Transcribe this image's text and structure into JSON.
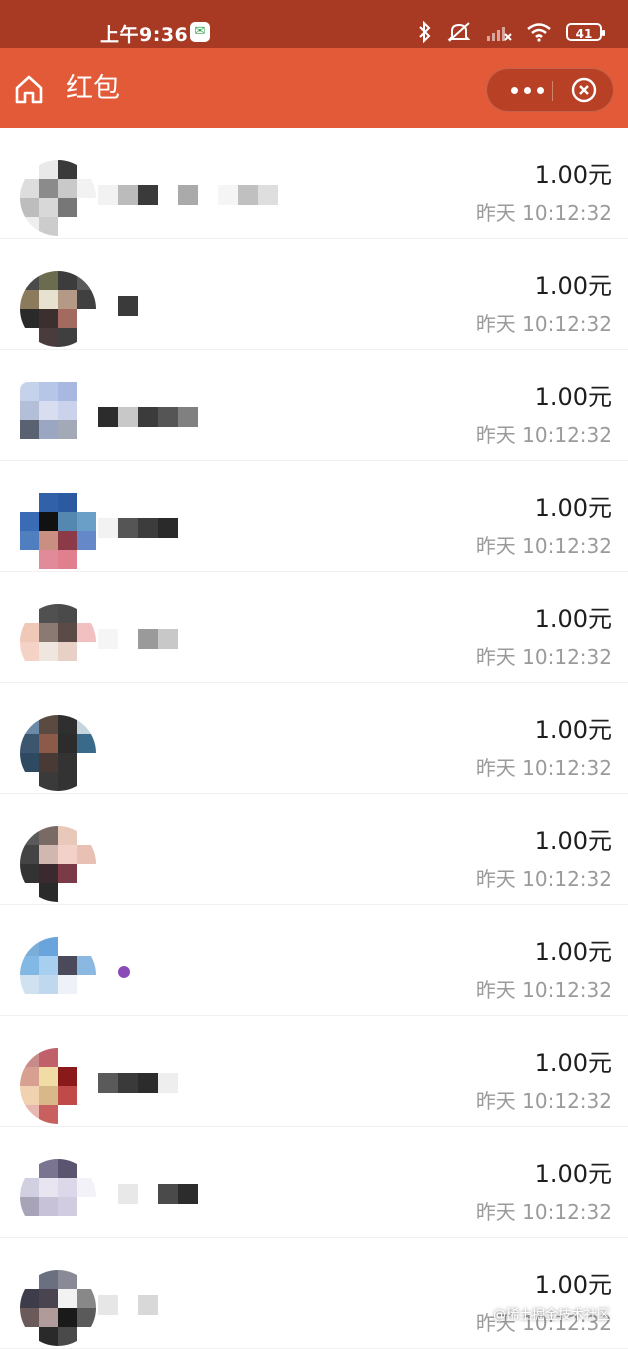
{
  "status_bar": {
    "time": "上午9:36",
    "app_badge": "wechat-icon",
    "battery": "41",
    "icons": [
      "bluetooth-icon",
      "silent-icon",
      "signal-icon",
      "wifi-icon",
      "battery-icon"
    ]
  },
  "nav": {
    "title": "红包",
    "home_icon": "home-icon",
    "more_icon": "more-dots-icon",
    "close_icon": "close-circle-icon"
  },
  "records": [
    {
      "amount": "1.00元",
      "time": "昨天 10:12:32"
    },
    {
      "amount": "1.00元",
      "time": "昨天 10:12:32"
    },
    {
      "amount": "1.00元",
      "time": "昨天 10:12:32"
    },
    {
      "amount": "1.00元",
      "time": "昨天 10:12:32"
    },
    {
      "amount": "1.00元",
      "time": "昨天 10:12:32"
    },
    {
      "amount": "1.00元",
      "time": "昨天 10:12:32"
    },
    {
      "amount": "1.00元",
      "time": "昨天 10:12:32"
    },
    {
      "amount": "1.00元",
      "time": "昨天 10:12:32"
    },
    {
      "amount": "1.00元",
      "time": "昨天 10:12:32"
    },
    {
      "amount": "1.00元",
      "time": "昨天 10:12:32"
    },
    {
      "amount": "1.00元",
      "time": "昨天 10:12:32"
    }
  ],
  "watermark": "@稀土掘金技术社区",
  "colors": {
    "status_bar": "#a83a24",
    "nav_bar": "#e35a38",
    "amount_text": "#1e1e1e",
    "time_text": "#9a9a9a"
  }
}
